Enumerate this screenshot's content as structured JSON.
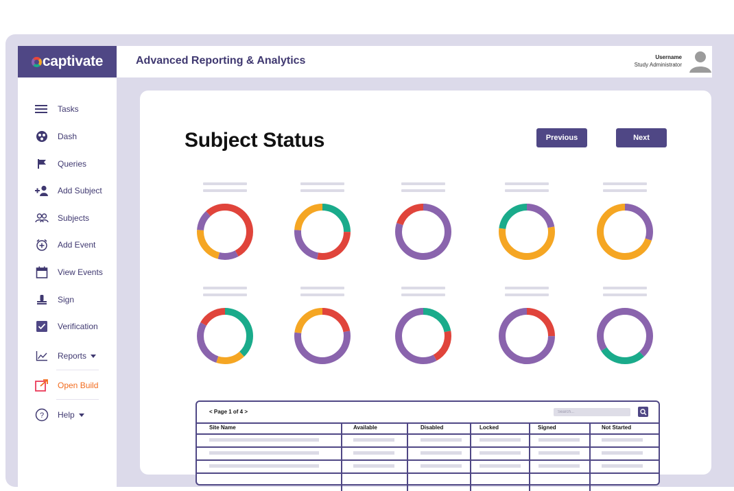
{
  "brand": {
    "name": "captivate",
    "colors": [
      "#e8463b",
      "#f5a623",
      "#1aab8b",
      "#8b62b3"
    ]
  },
  "app": {
    "title": "Advanced Reporting & Analytics"
  },
  "user": {
    "name": "Username",
    "role": "Study Administrator",
    "icon": "user-avatar-icon"
  },
  "sidebar": {
    "items": [
      {
        "label": "Tasks",
        "icon": "menu-lines-icon"
      },
      {
        "label": "Dash",
        "icon": "dashboard-icon"
      },
      {
        "label": "Queries",
        "icon": "flag-icon"
      },
      {
        "label": "Add Subject",
        "icon": "add-user-icon"
      },
      {
        "label": "Subjects",
        "icon": "users-icon"
      },
      {
        "label": "Add Event",
        "icon": "add-event-icon"
      },
      {
        "label": "View Events",
        "icon": "calendar-icon"
      },
      {
        "label": "Sign",
        "icon": "sign-icon"
      },
      {
        "label": "Verification",
        "icon": "checkbox-icon"
      },
      {
        "label": "Reports",
        "icon": "line-chart-icon"
      },
      {
        "label": "Open Build",
        "icon": "external-link-icon"
      },
      {
        "label": "Help",
        "icon": "help-icon"
      }
    ]
  },
  "main": {
    "title": "Subject Status",
    "prev_label": "Previous",
    "next_label": "Next"
  },
  "status_colors": {
    "red": "#e0443b",
    "orange": "#f5a623",
    "teal": "#1aab8b",
    "purple": "#8a64ad"
  },
  "donuts": [
    {
      "segments": [
        {
          "color": "red",
          "value": 0.42
        },
        {
          "color": "purple",
          "value": 0.12
        },
        {
          "color": "orange",
          "value": 0.22
        },
        {
          "color": "purple",
          "value": 0.12
        },
        {
          "color": "red",
          "value": 0.12
        }
      ]
    },
    {
      "segments": [
        {
          "color": "teal",
          "value": 0.25
        },
        {
          "color": "red",
          "value": 0.28
        },
        {
          "color": "purple",
          "value": 0.23
        },
        {
          "color": "orange",
          "value": 0.24
        }
      ]
    },
    {
      "segments": [
        {
          "color": "purple",
          "value": 0.8
        },
        {
          "color": "red",
          "value": 0.2
        }
      ]
    },
    {
      "segments": [
        {
          "color": "purple",
          "value": 0.22
        },
        {
          "color": "orange",
          "value": 0.55
        },
        {
          "color": "teal",
          "value": 0.23
        }
      ]
    },
    {
      "segments": [
        {
          "color": "purple",
          "value": 0.3
        },
        {
          "color": "orange",
          "value": 0.7
        }
      ]
    },
    {
      "segments": [
        {
          "color": "teal",
          "value": 0.38
        },
        {
          "color": "orange",
          "value": 0.17
        },
        {
          "color": "purple",
          "value": 0.28
        },
        {
          "color": "red",
          "value": 0.17
        }
      ]
    },
    {
      "segments": [
        {
          "color": "red",
          "value": 0.22
        },
        {
          "color": "purple",
          "value": 0.55
        },
        {
          "color": "orange",
          "value": 0.23
        }
      ]
    },
    {
      "segments": [
        {
          "color": "teal",
          "value": 0.22
        },
        {
          "color": "red",
          "value": 0.2
        },
        {
          "color": "purple",
          "value": 0.58
        }
      ]
    },
    {
      "segments": [
        {
          "color": "red",
          "value": 0.25
        },
        {
          "color": "purple",
          "value": 0.75
        }
      ]
    },
    {
      "segments": [
        {
          "color": "purple",
          "value": 0.38
        },
        {
          "color": "teal",
          "value": 0.28
        },
        {
          "color": "purple",
          "value": 0.34
        }
      ]
    }
  ],
  "table": {
    "pager": "< Page 1 of 4 >",
    "search_placeholder": "Search...",
    "columns": [
      "Site Name",
      "Available",
      "Disabled",
      "Locked",
      "Signed",
      "Not Started"
    ]
  }
}
